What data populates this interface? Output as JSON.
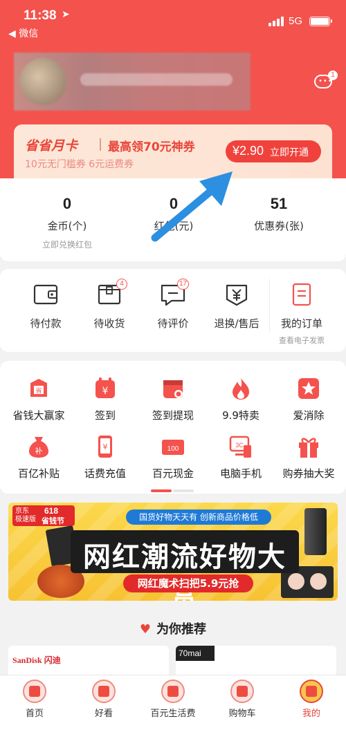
{
  "status_bar": {
    "time": "11:38",
    "back_app": "◀ 微信",
    "network": "5G"
  },
  "header": {
    "message_badge": "1"
  },
  "card_promo": {
    "title": "省省月卡",
    "subtitle": "最高领70元神券",
    "desc": "10元无门槛券  6元运费券",
    "price": "¥2.90",
    "cta": "立即开通"
  },
  "stats": [
    {
      "value": "0",
      "label": "金币(个)",
      "sub": "立即兑换红包"
    },
    {
      "value": "0",
      "label": "红包(元)",
      "sub": ""
    },
    {
      "value": "51",
      "label": "优惠券(张)",
      "sub": ""
    }
  ],
  "orders": [
    {
      "label": "待付款",
      "icon": "wallet-icon",
      "badge": ""
    },
    {
      "label": "待收货",
      "icon": "package-icon",
      "badge": "4"
    },
    {
      "label": "待评价",
      "icon": "comment-icon",
      "badge": "17"
    },
    {
      "label": "退换/售后",
      "icon": "refund-icon",
      "badge": ""
    },
    {
      "label": "我的订单",
      "icon": "orders-icon",
      "badge": "",
      "sub": "查看电子发票"
    }
  ],
  "services": [
    {
      "label": "省钱大赢家",
      "icon": "money-bag-icon",
      "glyph": "省"
    },
    {
      "label": "签到",
      "icon": "calendar-icon",
      "glyph": "¥"
    },
    {
      "label": "签到提现",
      "icon": "calendar-cash-icon",
      "glyph": ""
    },
    {
      "label": "9.9特卖",
      "icon": "flame-icon",
      "glyph": ""
    },
    {
      "label": "爱消除",
      "icon": "star-icon",
      "glyph": "★"
    },
    {
      "label": "百亿补贴",
      "icon": "subsidy-bag-icon",
      "glyph": "补"
    },
    {
      "label": "话费充值",
      "icon": "phone-icon",
      "glyph": "¥"
    },
    {
      "label": "百元现金",
      "icon": "cash-icon",
      "glyph": "100"
    },
    {
      "label": "电脑手机",
      "icon": "computer-icon",
      "glyph": "3C"
    },
    {
      "label": "购券抽大奖",
      "icon": "gift-icon",
      "glyph": ""
    }
  ],
  "promo_banner": {
    "tag_top": "京东",
    "tag_sub": "极速版",
    "tag_618": "618",
    "tag_fest": "省钱节",
    "topline": "国货好物天天有 创新商品价格低",
    "headline": "网红潮流好物大赏",
    "pill": "网红魔术扫把5.9元抢"
  },
  "recommend": {
    "title": "为你推荐",
    "card1_brand": "SanDisk 闪迪",
    "card2_brand": "70mai"
  },
  "tabbar": [
    {
      "label": "首页",
      "icon": "home-icon"
    },
    {
      "label": "好看",
      "icon": "video-icon"
    },
    {
      "label": "百元生活费",
      "icon": "allowance-icon"
    },
    {
      "label": "购物车",
      "icon": "cart-icon"
    },
    {
      "label": "我的",
      "icon": "profile-icon"
    }
  ],
  "colors": {
    "brand_red": "#f4524d",
    "accent": "#e8463a"
  }
}
